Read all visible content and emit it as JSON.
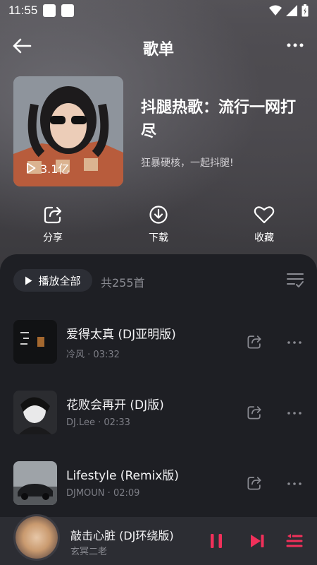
{
  "status_bar": {
    "time": "11:55"
  },
  "header": {
    "title": "歌单"
  },
  "playlist": {
    "play_count": "3.1亿",
    "title": "抖腿热歌：流行一网打尽",
    "description": "狂暴硬核，一起抖腿!"
  },
  "actions": [
    {
      "label": "分享",
      "icon": "share-icon"
    },
    {
      "label": "下载",
      "icon": "download-icon"
    },
    {
      "label": "收藏",
      "icon": "heart-icon"
    }
  ],
  "list": {
    "play_all_label": "播放全部",
    "count_label": "共255首",
    "songs": [
      {
        "title": "爱得太真 (DJ亚明版)",
        "artist": "冷风",
        "duration": "03:32"
      },
      {
        "title": "花败会再开 (DJ版)",
        "artist": "DJ.Lee",
        "duration": "02:33"
      },
      {
        "title": "Lifestyle (Remix版)",
        "artist": "DJMOUN",
        "duration": "02:09"
      }
    ]
  },
  "mini_player": {
    "title": "敲击心脏 (DJ环绕版)",
    "artist": "玄冥二老"
  },
  "colors": {
    "accent": "#f0305a",
    "panel": "#1e1f24",
    "muted_text": "#7d7e86"
  }
}
